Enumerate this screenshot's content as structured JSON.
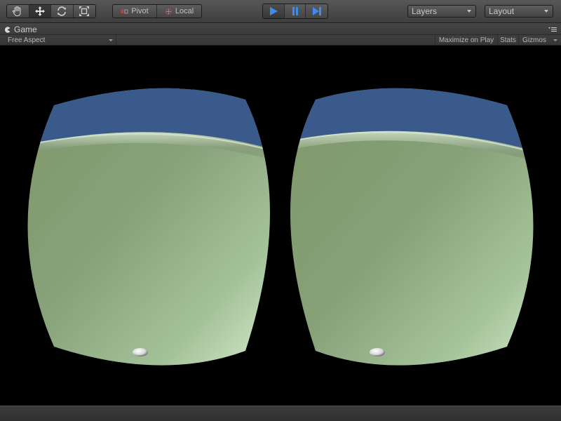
{
  "toolbar": {
    "tools": [
      {
        "name": "hand-tool",
        "icon": "hand-icon"
      },
      {
        "name": "move-tool",
        "icon": "move-arrows-icon",
        "active": true
      },
      {
        "name": "rotate-tool",
        "icon": "rotate-icon"
      },
      {
        "name": "scale-tool",
        "icon": "scale-icon"
      }
    ],
    "pivot_label": "Pivot",
    "local_label": "Local",
    "play_controls": [
      "play-icon",
      "pause-icon",
      "step-icon"
    ],
    "layers_label": "Layers",
    "layout_label": "Layout"
  },
  "game_panel": {
    "tab_label": "Game",
    "aspect_label": "Free Aspect",
    "maximize_label": "Maximize on Play",
    "stats_label": "Stats",
    "gizmos_label": "Gizmos"
  },
  "colors": {
    "accent_blue": "#3f8cf0",
    "sky": "#3a5a8c",
    "ground": "#8ea878",
    "ground_light": "#d4eccb"
  }
}
